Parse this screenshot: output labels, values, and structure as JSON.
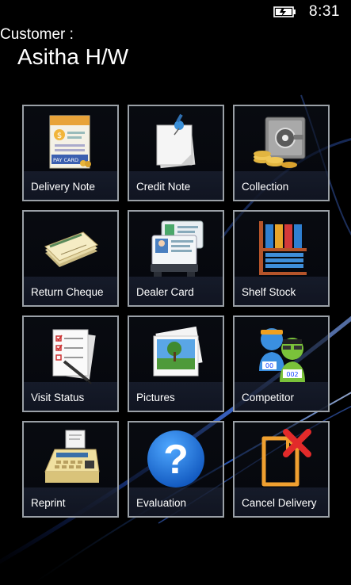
{
  "status_bar": {
    "time": "8:31",
    "battery_icon": "battery-charging-icon"
  },
  "header": {
    "customer_label": "Customer :",
    "customer_name": "Asitha H/W"
  },
  "tiles": [
    {
      "label": "Delivery Note",
      "icon": "delivery-note-icon",
      "icon_text": "PAY CARD"
    },
    {
      "label": "Credit Note",
      "icon": "credit-note-icon"
    },
    {
      "label": "Collection",
      "icon": "collection-safe-icon"
    },
    {
      "label": "Return Cheque",
      "icon": "cheque-icon"
    },
    {
      "label": "Dealer Card",
      "icon": "dealer-card-icon"
    },
    {
      "label": "Shelf Stock",
      "icon": "shelf-stock-icon"
    },
    {
      "label": "Visit Status",
      "icon": "checklist-icon"
    },
    {
      "label": "Pictures",
      "icon": "pictures-icon"
    },
    {
      "label": "Competitor",
      "icon": "competitor-icon",
      "icon_text_1": "00",
      "icon_text_2": "002"
    },
    {
      "label": "Reprint",
      "icon": "printer-icon"
    },
    {
      "label": "Evaluation",
      "icon": "question-icon",
      "icon_text": "?"
    },
    {
      "label": "Cancel Delivery",
      "icon": "cancel-delivery-icon"
    }
  ],
  "colors": {
    "background": "#000000",
    "tile_border": "#9aa0a6",
    "swoosh": "#2d5fd6"
  }
}
